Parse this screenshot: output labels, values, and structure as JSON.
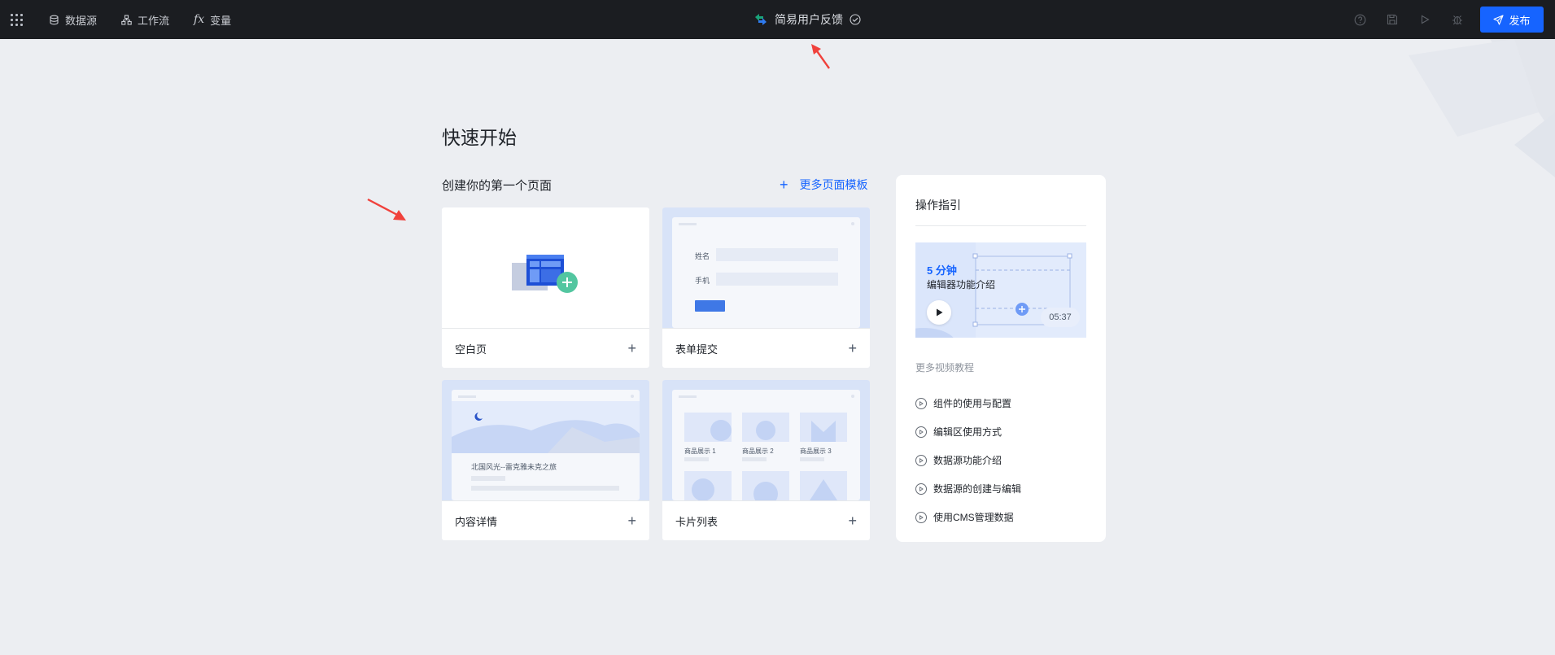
{
  "topbar": {
    "nav": [
      {
        "label": "数据源",
        "icon": "database-icon"
      },
      {
        "label": "工作流",
        "icon": "workflow-icon"
      },
      {
        "label": "变量",
        "icon": "function-icon"
      }
    ],
    "app_title": "简易用户反馈",
    "publish_label": "发布",
    "colors": {
      "bar": "#1b1d21",
      "primary": "#1664ff"
    }
  },
  "main": {
    "title": "快速开始",
    "subtitle": "创建你的第一个页面",
    "more_templates": "更多页面模板",
    "cards": [
      {
        "label": "空白页"
      },
      {
        "label": "表单提交",
        "preview": {
          "field_1": "姓名",
          "field_2": "手机"
        }
      },
      {
        "label": "内容详情",
        "preview": {
          "headline": "北国风光--雷克雅未克之旅"
        }
      },
      {
        "label": "卡片列表",
        "preview": {
          "items": [
            "商品展示 1",
            "商品展示 2",
            "商品展示 3"
          ]
        }
      }
    ]
  },
  "guide": {
    "title": "操作指引",
    "video": {
      "title": "5 分钟",
      "subtitle": "编辑器功能介绍",
      "duration": "05:37"
    },
    "more_label": "更多视频教程",
    "items": [
      "组件的使用与配置",
      "编辑区使用方式",
      "数据源功能介绍",
      "数据源的创建与编辑",
      "使用CMS管理数据"
    ]
  }
}
